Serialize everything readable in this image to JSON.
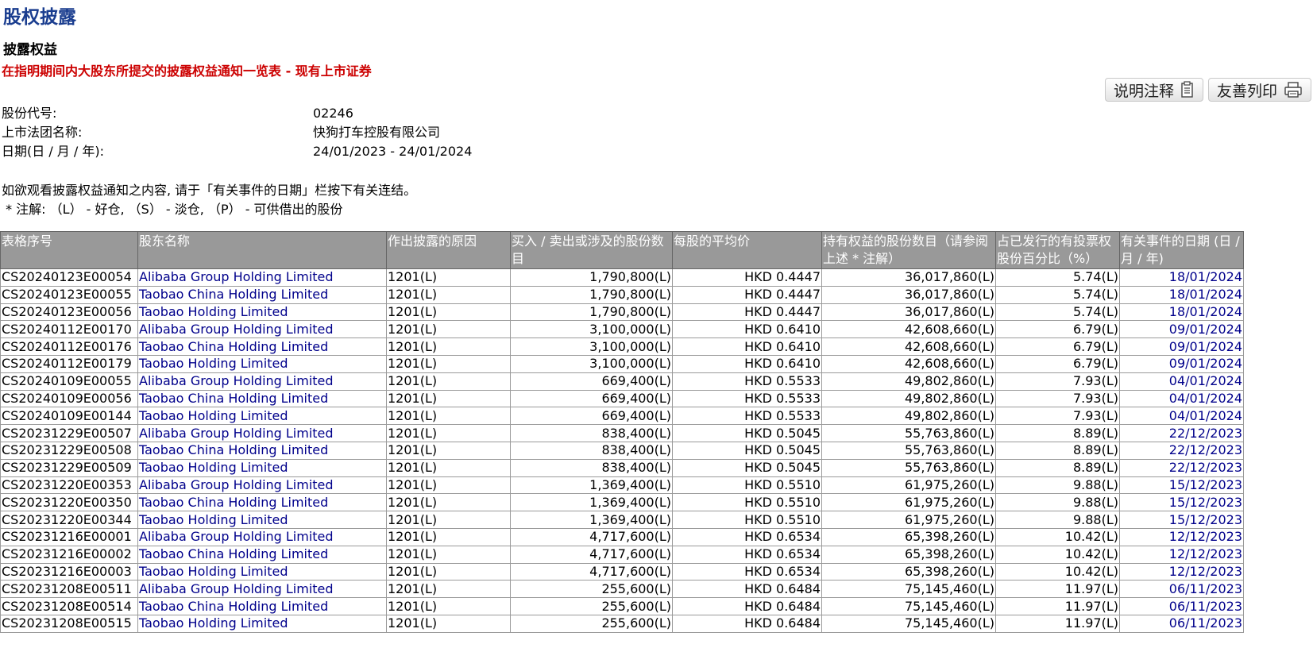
{
  "page": {
    "title": "股权披露",
    "section_title": "披露权益",
    "subtitle": "在指明期间内大股东所提交的披露权益通知一览表 - 现有上市证券"
  },
  "toolbar": {
    "notes_label": "说明注释",
    "print_label": "友善列印"
  },
  "info": {
    "stock_code_label": "股份代号:",
    "stock_code": "02246",
    "company_label": "上市法团名称:",
    "company": "快狗打车控股有限公司",
    "date_label": "日期(日 / 月 / 年):",
    "date_range": "24/01/2023 - 24/01/2024"
  },
  "notes": {
    "line1": "如欲观看披露权益通知之内容, 请于「有关事件的日期」栏按下有关连结。",
    "line2": " * 注解: （L） - 好仓, （S） - 淡仓, （P） - 可供借出的股份"
  },
  "table": {
    "headers": [
      "表格序号",
      "股东名称",
      "作出披露的原因",
      "买入 / 卖出或涉及的股份数目",
      "每股的平均价",
      "持有权益的股份数目（请参阅上述 * 注解）",
      "占已发行的有投票权股份百分比（%）",
      "有关事件的日期 (日 / 月 / 年)"
    ],
    "rows": [
      [
        "CS20240123E00054",
        "Alibaba Group Holding Limited",
        "1201(L)",
        "1,790,800(L)",
        "HKD 0.4447",
        "36,017,860(L)",
        "5.74(L)",
        "18/01/2024"
      ],
      [
        "CS20240123E00055",
        "Taobao China Holding Limited",
        "1201(L)",
        "1,790,800(L)",
        "HKD 0.4447",
        "36,017,860(L)",
        "5.74(L)",
        "18/01/2024"
      ],
      [
        "CS20240123E00056",
        "Taobao Holding Limited",
        "1201(L)",
        "1,790,800(L)",
        "HKD 0.4447",
        "36,017,860(L)",
        "5.74(L)",
        "18/01/2024"
      ],
      [
        "CS20240112E00170",
        "Alibaba Group Holding Limited",
        "1201(L)",
        "3,100,000(L)",
        "HKD 0.6410",
        "42,608,660(L)",
        "6.79(L)",
        "09/01/2024"
      ],
      [
        "CS20240112E00176",
        "Taobao China Holding Limited",
        "1201(L)",
        "3,100,000(L)",
        "HKD 0.6410",
        "42,608,660(L)",
        "6.79(L)",
        "09/01/2024"
      ],
      [
        "CS20240112E00179",
        "Taobao Holding Limited",
        "1201(L)",
        "3,100,000(L)",
        "HKD 0.6410",
        "42,608,660(L)",
        "6.79(L)",
        "09/01/2024"
      ],
      [
        "CS20240109E00055",
        "Alibaba Group Holding Limited",
        "1201(L)",
        "669,400(L)",
        "HKD 0.5533",
        "49,802,860(L)",
        "7.93(L)",
        "04/01/2024"
      ],
      [
        "CS20240109E00056",
        "Taobao China Holding Limited",
        "1201(L)",
        "669,400(L)",
        "HKD 0.5533",
        "49,802,860(L)",
        "7.93(L)",
        "04/01/2024"
      ],
      [
        "CS20240109E00144",
        "Taobao Holding Limited",
        "1201(L)",
        "669,400(L)",
        "HKD 0.5533",
        "49,802,860(L)",
        "7.93(L)",
        "04/01/2024"
      ],
      [
        "CS20231229E00507",
        "Alibaba Group Holding Limited",
        "1201(L)",
        "838,400(L)",
        "HKD 0.5045",
        "55,763,860(L)",
        "8.89(L)",
        "22/12/2023"
      ],
      [
        "CS20231229E00508",
        "Taobao China Holding Limited",
        "1201(L)",
        "838,400(L)",
        "HKD 0.5045",
        "55,763,860(L)",
        "8.89(L)",
        "22/12/2023"
      ],
      [
        "CS20231229E00509",
        "Taobao Holding Limited",
        "1201(L)",
        "838,400(L)",
        "HKD 0.5045",
        "55,763,860(L)",
        "8.89(L)",
        "22/12/2023"
      ],
      [
        "CS20231220E00353",
        "Alibaba Group Holding Limited",
        "1201(L)",
        "1,369,400(L)",
        "HKD 0.5510",
        "61,975,260(L)",
        "9.88(L)",
        "15/12/2023"
      ],
      [
        "CS20231220E00350",
        "Taobao China Holding Limited",
        "1201(L)",
        "1,369,400(L)",
        "HKD 0.5510",
        "61,975,260(L)",
        "9.88(L)",
        "15/12/2023"
      ],
      [
        "CS20231220E00344",
        "Taobao Holding Limited",
        "1201(L)",
        "1,369,400(L)",
        "HKD 0.5510",
        "61,975,260(L)",
        "9.88(L)",
        "15/12/2023"
      ],
      [
        "CS20231216E00001",
        "Alibaba Group Holding Limited",
        "1201(L)",
        "4,717,600(L)",
        "HKD 0.6534",
        "65,398,260(L)",
        "10.42(L)",
        "12/12/2023"
      ],
      [
        "CS20231216E00002",
        "Taobao China Holding Limited",
        "1201(L)",
        "4,717,600(L)",
        "HKD 0.6534",
        "65,398,260(L)",
        "10.42(L)",
        "12/12/2023"
      ],
      [
        "CS20231216E00003",
        "Taobao Holding Limited",
        "1201(L)",
        "4,717,600(L)",
        "HKD 0.6534",
        "65,398,260(L)",
        "10.42(L)",
        "12/12/2023"
      ],
      [
        "CS20231208E00511",
        "Alibaba Group Holding Limited",
        "1201(L)",
        "255,600(L)",
        "HKD 0.6484",
        "75,145,460(L)",
        "11.97(L)",
        "06/11/2023"
      ],
      [
        "CS20231208E00514",
        "Taobao China Holding Limited",
        "1201(L)",
        "255,600(L)",
        "HKD 0.6484",
        "75,145,460(L)",
        "11.97(L)",
        "06/11/2023"
      ],
      [
        "CS20231208E00515",
        "Taobao Holding Limited",
        "1201(L)",
        "255,600(L)",
        "HKD 0.6484",
        "75,145,460(L)",
        "11.97(L)",
        "06/11/2023"
      ]
    ]
  },
  "colors": {
    "title": "#1a3d8f",
    "subtitle": "#cc0000",
    "header_bg": "#999999",
    "link": "#00008b"
  },
  "icons": {
    "notes": "document-icon",
    "print": "printer-icon"
  }
}
